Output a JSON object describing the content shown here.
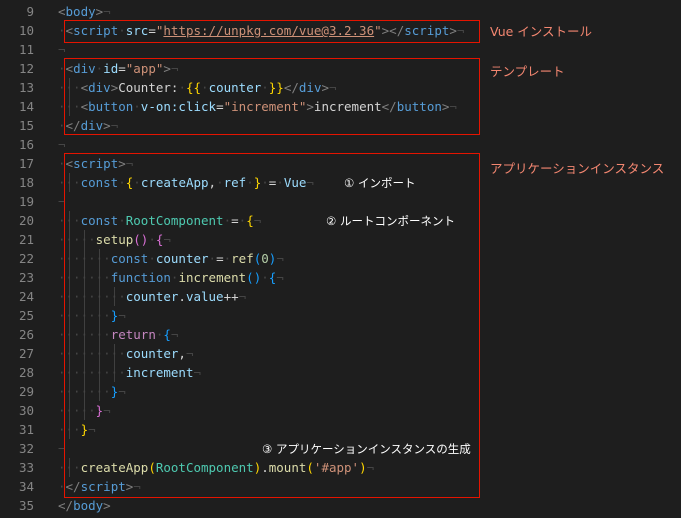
{
  "editor": {
    "lines": [
      {
        "num": "9",
        "tokens": [
          [
            "t-punct",
            "<"
          ],
          [
            "t-tag",
            "body"
          ],
          [
            "t-punct",
            ">"
          ],
          [
            "eol",
            "¬"
          ]
        ]
      },
      {
        "num": "10",
        "tokens": [
          [
            "dot",
            "·"
          ],
          [
            "t-punct",
            "<"
          ],
          [
            "t-tag",
            "script"
          ],
          [
            "dot",
            "·"
          ],
          [
            "t-attr",
            "src"
          ],
          [
            "t-op",
            "="
          ],
          [
            "t-str",
            "\""
          ],
          [
            "t-url",
            "https://unpkg.com/vue@3.2.36"
          ],
          [
            "t-str",
            "\""
          ],
          [
            "t-punct",
            "></"
          ],
          [
            "t-tag",
            "script"
          ],
          [
            "t-punct",
            ">"
          ],
          [
            "eol",
            "¬"
          ]
        ]
      },
      {
        "num": "11",
        "tokens": [
          [
            "eol",
            "¬"
          ]
        ]
      },
      {
        "num": "12",
        "tokens": [
          [
            "dot",
            "·"
          ],
          [
            "t-punct",
            "<"
          ],
          [
            "t-tag",
            "div"
          ],
          [
            "dot",
            "·"
          ],
          [
            "t-attr",
            "id"
          ],
          [
            "t-op",
            "="
          ],
          [
            "t-str",
            "\"app\""
          ],
          [
            "t-punct",
            ">"
          ],
          [
            "eol",
            "¬"
          ]
        ]
      },
      {
        "num": "13",
        "tokens": [
          [
            "dot",
            "···"
          ],
          [
            "t-punct",
            "<"
          ],
          [
            "t-tag",
            "div"
          ],
          [
            "t-punct",
            ">"
          ],
          [
            "t-text",
            "Counter:"
          ],
          [
            "dot",
            "·"
          ],
          [
            "b-gold",
            "{{"
          ],
          [
            "dot",
            "·"
          ],
          [
            "t-var",
            "counter"
          ],
          [
            "dot",
            "·"
          ],
          [
            "b-gold",
            "}}"
          ],
          [
            "t-punct",
            "</"
          ],
          [
            "t-tag",
            "div"
          ],
          [
            "t-punct",
            ">"
          ],
          [
            "eol",
            "¬"
          ]
        ]
      },
      {
        "num": "14",
        "tokens": [
          [
            "dot",
            "···"
          ],
          [
            "t-punct",
            "<"
          ],
          [
            "t-tag",
            "button"
          ],
          [
            "dot",
            "·"
          ],
          [
            "t-attr",
            "v-on:click"
          ],
          [
            "t-op",
            "="
          ],
          [
            "t-str",
            "\"increment\""
          ],
          [
            "t-punct",
            ">"
          ],
          [
            "t-text",
            "increment"
          ],
          [
            "t-punct",
            "</"
          ],
          [
            "t-tag",
            "button"
          ],
          [
            "t-punct",
            ">"
          ],
          [
            "eol",
            "¬"
          ]
        ]
      },
      {
        "num": "15",
        "tokens": [
          [
            "dot",
            "·"
          ],
          [
            "t-punct",
            "</"
          ],
          [
            "t-tag",
            "div"
          ],
          [
            "t-punct",
            ">"
          ],
          [
            "eol",
            "¬"
          ]
        ]
      },
      {
        "num": "16",
        "tokens": [
          [
            "eol",
            "¬"
          ]
        ]
      },
      {
        "num": "17",
        "tokens": [
          [
            "dot",
            "·"
          ],
          [
            "t-punct",
            "<"
          ],
          [
            "t-tag",
            "script"
          ],
          [
            "t-punct",
            ">"
          ],
          [
            "eol",
            "¬"
          ]
        ]
      },
      {
        "num": "18",
        "tokens": [
          [
            "dot",
            "···"
          ],
          [
            "t-kw",
            "const"
          ],
          [
            "dot",
            "·"
          ],
          [
            "b-gold",
            "{"
          ],
          [
            "dot",
            "·"
          ],
          [
            "t-var",
            "createApp"
          ],
          [
            "t-op",
            ","
          ],
          [
            "dot",
            "·"
          ],
          [
            "t-var",
            "ref"
          ],
          [
            "dot",
            "·"
          ],
          [
            "b-gold",
            "}"
          ],
          [
            "dot",
            "·"
          ],
          [
            "t-op",
            "="
          ],
          [
            "dot",
            "·"
          ],
          [
            "t-var",
            "Vue"
          ],
          [
            "eol",
            "¬"
          ]
        ]
      },
      {
        "num": "19",
        "tokens": [
          [
            "eol",
            "¬"
          ]
        ]
      },
      {
        "num": "20",
        "tokens": [
          [
            "dot",
            "···"
          ],
          [
            "t-kw",
            "const"
          ],
          [
            "dot",
            "·"
          ],
          [
            "t-cls",
            "RootComponent"
          ],
          [
            "dot",
            "·"
          ],
          [
            "t-op",
            "="
          ],
          [
            "dot",
            "·"
          ],
          [
            "b-gold",
            "{"
          ],
          [
            "eol",
            "¬"
          ]
        ]
      },
      {
        "num": "21",
        "tokens": [
          [
            "dot",
            "·····"
          ],
          [
            "t-fn",
            "setup"
          ],
          [
            "b-purple",
            "()"
          ],
          [
            "dot",
            "·"
          ],
          [
            "b-purple",
            "{"
          ],
          [
            "eol",
            "¬"
          ]
        ]
      },
      {
        "num": "22",
        "tokens": [
          [
            "dot",
            "·······"
          ],
          [
            "t-kw",
            "const"
          ],
          [
            "dot",
            "·"
          ],
          [
            "t-var",
            "counter"
          ],
          [
            "dot",
            "·"
          ],
          [
            "t-op",
            "="
          ],
          [
            "dot",
            "·"
          ],
          [
            "t-fn",
            "ref"
          ],
          [
            "b-blue",
            "("
          ],
          [
            "t-num",
            "0"
          ],
          [
            "b-blue",
            ")"
          ],
          [
            "eol",
            "¬"
          ]
        ]
      },
      {
        "num": "23",
        "tokens": [
          [
            "dot",
            "·······"
          ],
          [
            "t-kw",
            "function"
          ],
          [
            "dot",
            "·"
          ],
          [
            "t-fn",
            "increment"
          ],
          [
            "b-blue",
            "()"
          ],
          [
            "dot",
            "·"
          ],
          [
            "b-blue",
            "{"
          ],
          [
            "eol",
            "¬"
          ]
        ]
      },
      {
        "num": "24",
        "tokens": [
          [
            "dot",
            "·········"
          ],
          [
            "t-var",
            "counter"
          ],
          [
            "t-op",
            "."
          ],
          [
            "t-var",
            "value"
          ],
          [
            "t-op",
            "++"
          ],
          [
            "eol",
            "¬"
          ]
        ]
      },
      {
        "num": "25",
        "tokens": [
          [
            "dot",
            "·······"
          ],
          [
            "b-blue",
            "}"
          ],
          [
            "eol",
            "¬"
          ]
        ]
      },
      {
        "num": "26",
        "tokens": [
          [
            "dot",
            "·······"
          ],
          [
            "t-ctrl",
            "return"
          ],
          [
            "dot",
            "·"
          ],
          [
            "b-blue",
            "{"
          ],
          [
            "eol",
            "¬"
          ]
        ]
      },
      {
        "num": "27",
        "tokens": [
          [
            "dot",
            "·········"
          ],
          [
            "t-var",
            "counter"
          ],
          [
            "t-op",
            ","
          ],
          [
            "eol",
            "¬"
          ]
        ]
      },
      {
        "num": "28",
        "tokens": [
          [
            "dot",
            "·········"
          ],
          [
            "t-var",
            "increment"
          ],
          [
            "eol",
            "¬"
          ]
        ]
      },
      {
        "num": "29",
        "tokens": [
          [
            "dot",
            "·······"
          ],
          [
            "b-blue",
            "}"
          ],
          [
            "eol",
            "¬"
          ]
        ]
      },
      {
        "num": "30",
        "tokens": [
          [
            "dot",
            "·····"
          ],
          [
            "b-purple",
            "}"
          ],
          [
            "eol",
            "¬"
          ]
        ]
      },
      {
        "num": "31",
        "tokens": [
          [
            "dot",
            "···"
          ],
          [
            "b-gold",
            "}"
          ],
          [
            "eol",
            "¬"
          ]
        ]
      },
      {
        "num": "32",
        "tokens": [
          [
            "eol",
            "¬"
          ]
        ]
      },
      {
        "num": "33",
        "tokens": [
          [
            "dot",
            "···"
          ],
          [
            "t-fn",
            "createApp"
          ],
          [
            "b-gold",
            "("
          ],
          [
            "t-cls",
            "RootComponent"
          ],
          [
            "b-gold",
            ")"
          ],
          [
            "t-op",
            "."
          ],
          [
            "t-fn",
            "mount"
          ],
          [
            "b-gold",
            "("
          ],
          [
            "t-str",
            "'#app'"
          ],
          [
            "b-gold",
            ")"
          ],
          [
            "eol",
            "¬"
          ]
        ]
      },
      {
        "num": "34",
        "tokens": [
          [
            "dot",
            "·"
          ],
          [
            "t-punct",
            "</"
          ],
          [
            "t-tag",
            "script"
          ],
          [
            "t-punct",
            ">"
          ],
          [
            "eol",
            "¬"
          ]
        ]
      },
      {
        "num": "35",
        "tokens": [
          [
            "t-punct",
            "</"
          ],
          [
            "t-tag",
            "body"
          ],
          [
            "t-punct",
            ">"
          ]
        ]
      }
    ]
  },
  "annotations": {
    "vue_install_label": "Vue インストール",
    "template_label": "テンプレート",
    "app_instance_label": "アプリケーションインスタンス",
    "note_import": "① インポート",
    "note_root_component": "② ルートコンポーネント",
    "note_create_app": "③ アプリケーションインスタンスの生成"
  },
  "colors": {
    "background": "#1e1e1e",
    "line_number": "#858585",
    "annotation_box": "#e51400",
    "annotation_label": "#f48771"
  }
}
